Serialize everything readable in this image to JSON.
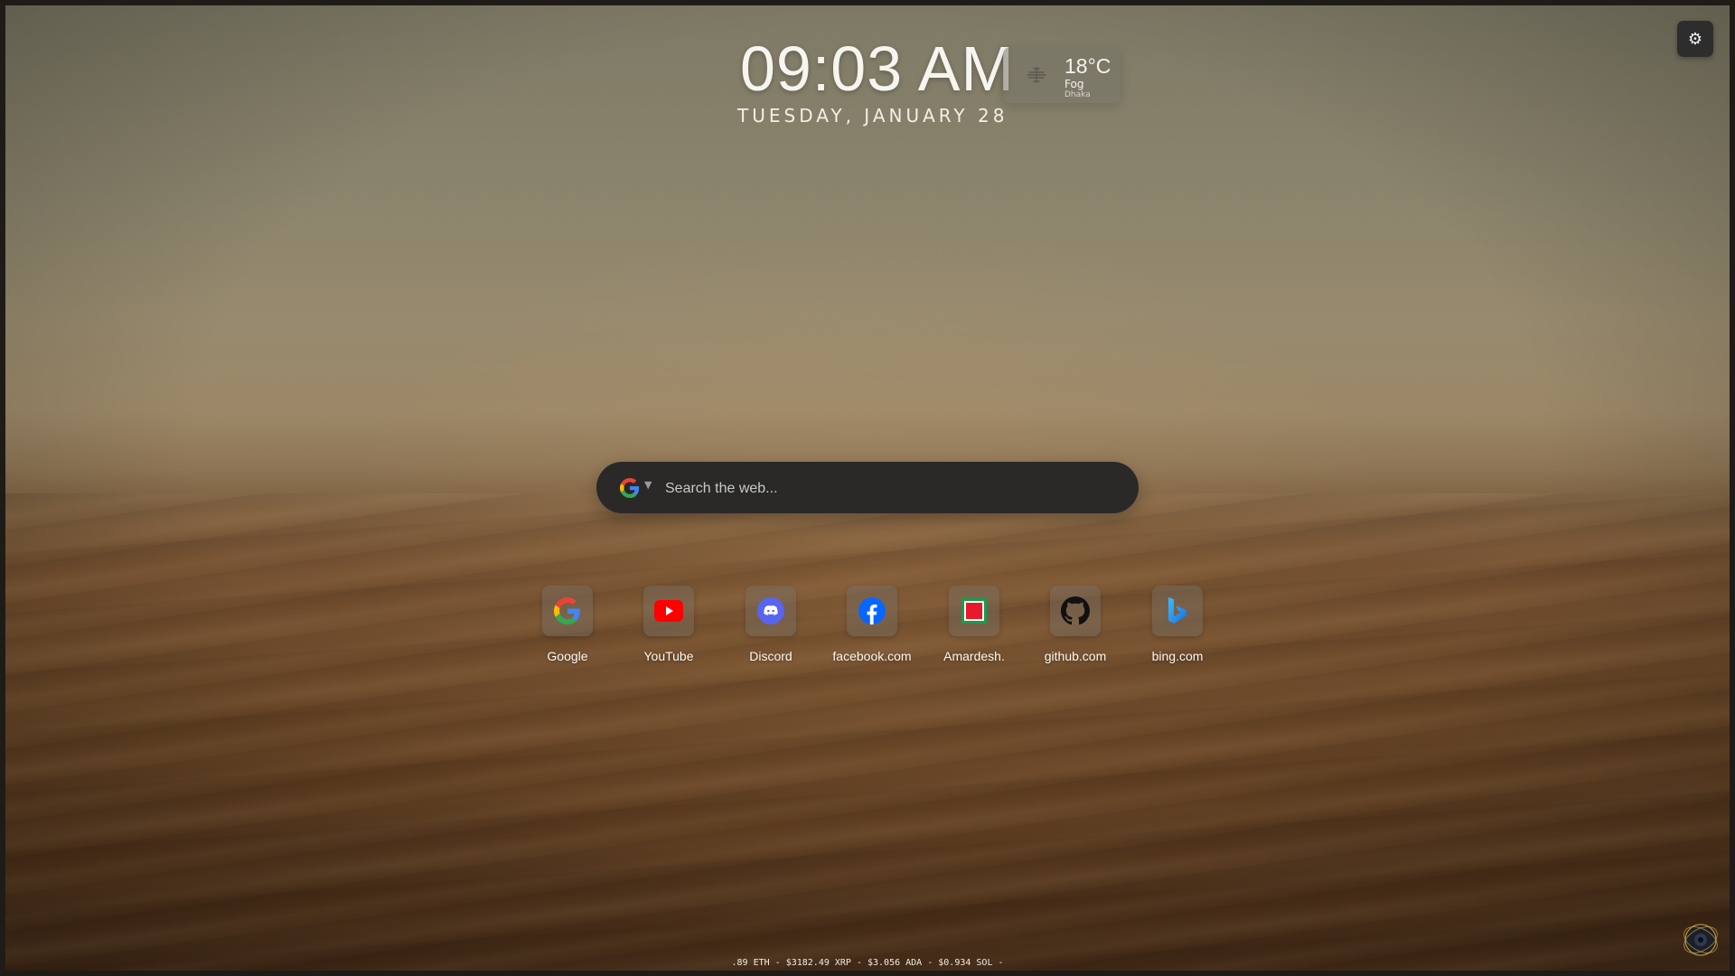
{
  "clock": {
    "time": "09:03 AM",
    "date": "TUESDAY, JANUARY 28"
  },
  "weather": {
    "temperature": "18°C",
    "condition": "Fog",
    "city": "Dhaka",
    "icon": "fog-icon"
  },
  "settings": {
    "icon": "gear-icon",
    "glyph": "⚙"
  },
  "search": {
    "engine_icon": "google-icon",
    "caret": "▼",
    "placeholder": "Search the web..."
  },
  "shortcuts": [
    {
      "label": "Google",
      "icon": "google-icon"
    },
    {
      "label": "YouTube",
      "icon": "youtube-icon"
    },
    {
      "label": "Discord",
      "icon": "discord-icon"
    },
    {
      "label": "facebook.com",
      "icon": "facebook-icon"
    },
    {
      "label": "Amardesh.",
      "icon": "amardesh-icon"
    },
    {
      "label": "github.com",
      "icon": "github-icon"
    },
    {
      "label": "bing.com",
      "icon": "bing-icon"
    }
  ],
  "ticker": {
    "text": ".89 ETH - $3182.49 XRP - $3.056 ADA - $0.934 SOL -"
  },
  "colors": {
    "search_bg": "#2a2928",
    "settings_bg": "#2d2d2d",
    "youtube_red": "#ff0000",
    "discord_blurple": "#5865f2",
    "facebook_blue": "#0866ff"
  }
}
